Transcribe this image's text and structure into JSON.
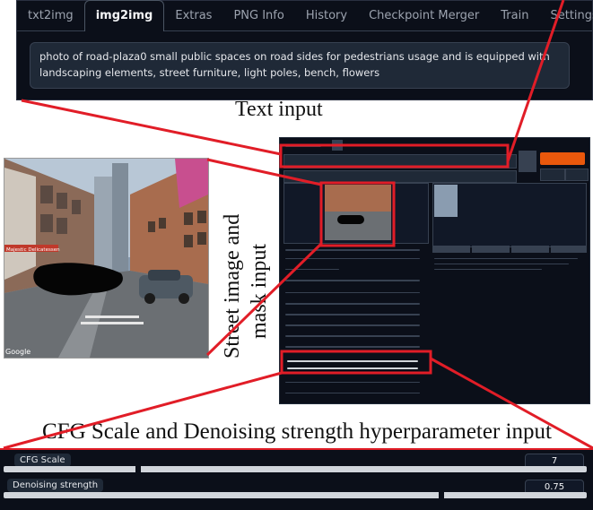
{
  "tabs": [
    "txt2img",
    "img2img",
    "Extras",
    "PNG Info",
    "History",
    "Checkpoint Merger",
    "Train",
    "Settings"
  ],
  "active_tab": "img2img",
  "prompt": "photo of road-plaza0 small public spaces on road sides for pedestrians usage and is equipped with landscaping elements, street furniture, light poles, bench, flowers",
  "captions": {
    "text_input": "Text input",
    "street_input": [
      "Street image and",
      "mask input"
    ],
    "hyperparameter": "CFG Scale and Denoising strength hyperparameter input"
  },
  "street_image": {
    "watermark": "Google",
    "shop_sign": "Majestic Delicatessen"
  },
  "sliders": {
    "cfg": {
      "label": "CFG Scale",
      "value": "7",
      "level": 0.23
    },
    "denoise": {
      "label": "Denoising strength",
      "value": "0.75",
      "level": 0.75
    }
  },
  "colors": {
    "highlight": "#e11d27",
    "ui_bg": "#0b0f19",
    "generate_button": "#ea580c"
  }
}
